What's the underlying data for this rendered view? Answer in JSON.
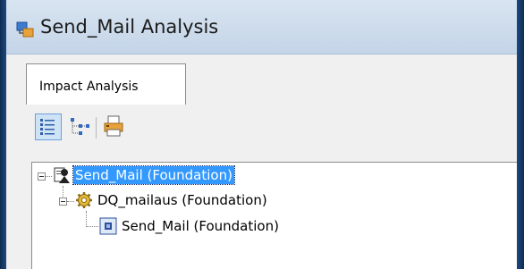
{
  "window": {
    "title": "Send_Mail Analysis"
  },
  "tabs": [
    {
      "label": "Impact Analysis",
      "active": true
    }
  ],
  "toolbar": {
    "buttons": [
      {
        "icon": "list-view-icon",
        "pressed": true
      },
      {
        "icon": "tree-view-icon",
        "pressed": false
      },
      {
        "icon": "print-icon",
        "pressed": false
      }
    ]
  },
  "tree": {
    "nodes": [
      {
        "label": "Send_Mail (Foundation)",
        "icon": "agent-icon",
        "level": 0,
        "expanded": true,
        "selected": true
      },
      {
        "label": "DQ_mailaus (Foundation)",
        "icon": "gear-icon",
        "level": 1,
        "expanded": true,
        "selected": false
      },
      {
        "label": "Send_Mail (Foundation)",
        "icon": "form-icon",
        "level": 2,
        "expanded": false,
        "selected": false
      }
    ]
  },
  "colors": {
    "selection": "#3399ff",
    "titlebar": "#cddbea",
    "frame": "#163a66"
  }
}
